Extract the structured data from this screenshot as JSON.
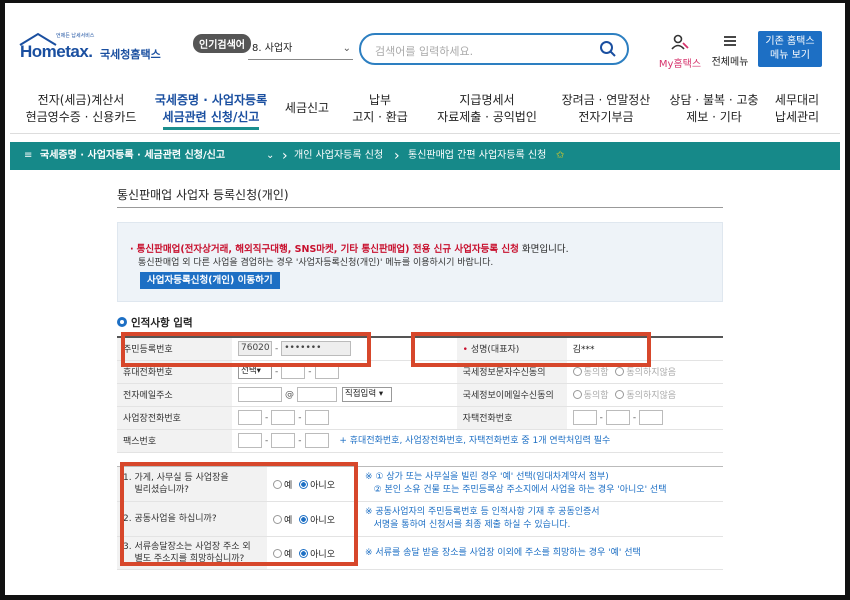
{
  "header": {
    "logo_text": "Hometax.",
    "logo_sub": "국세청홈택스",
    "logo_tiny": "언제든 납세서비스",
    "popular_badge": "인기검색어",
    "popular_item": "8.  사업자",
    "search_placeholder": "검색어를 입력하세요.",
    "my_home": "My홈택스",
    "all_menu": "전체메뉴",
    "old_button_line1": "기존 홈택스",
    "old_button_line2": "메뉴 보기"
  },
  "gnb": [
    {
      "line1": "전자(세금)계산서",
      "line2": "현금영수증 · 신용카드"
    },
    {
      "line1": "국세증명 · 사업자등록",
      "line2": "세금관련 신청/신고"
    },
    {
      "line1": "세금신고",
      "line2": ""
    },
    {
      "line1": "납부",
      "line2": "고지 · 환급"
    },
    {
      "line1": "지급명세서",
      "line2": "자료제출 · 공익법인"
    },
    {
      "line1": "장려금 · 연말정산",
      "line2": "전자기부금"
    },
    {
      "line1": "상담 · 불복 · 고충",
      "line2": "제보 · 기타"
    },
    {
      "line1": "세무대리",
      "line2": "납세관리"
    }
  ],
  "breadcrumb": {
    "menu": "국세증명 · 사업자등록 · 세금관련 신청/신고",
    "step1": "개인 사업자등록 신청",
    "step2": "통신판매업 간편 사업자등록 신청",
    "star": "✩"
  },
  "page": {
    "title": "통신판매업 사업자 등록신청(개인)",
    "notice_bullet": "·",
    "notice_red": "통신판매업(전자상거래, 해외직구대행, SNS마켓, 기타 통신판매업) 전용 신규 사업자등록 신청",
    "notice_after": " 화면입니다.",
    "notice_line2": "통신판매업 외 다른 사업을 겸업하는 경우 '사업자등록신청(개인)' 메뉴를 이용하시기 바랍니다.",
    "notice_button": "사업자등록신청(개인) 이동하기",
    "section_title": "인적사항 입력"
  },
  "form": {
    "rrn_label": "주민등록번호",
    "rrn_front": "76020",
    "rrn_back": "•••••••",
    "name_label": "성명(대표자)",
    "name_value": "김***",
    "mobile_label": "휴대전화번호",
    "mobile_select": "선택",
    "info_sms_label": "국세정보문자수신동의",
    "agree": "동의함",
    "disagree": "동의하지않음",
    "email_label": "전자메일주소",
    "email_at": "@",
    "email_select": "직접입력",
    "info_email_label": "국세정보이메일수신동의",
    "biz_phone_label": "사업장전화번호",
    "home_phone_label": "자택전화번호",
    "fax_label": "팩스번호",
    "contact_hint": "+ 휴대전화번호, 사업장전화번호, 자택전화번호 중 1개 연락처입력 필수"
  },
  "questions": [
    {
      "q_line1": "1. 가게, 사무실 등 사업장을",
      "q_line2": "빌리셨습니까?",
      "yes": "예",
      "no": "아니오",
      "note_line1": "※ ① 상가 또는 사무실을 빌린 경우 '예' 선택(임대차계약서 첨부)",
      "note_line2": "② 본인 소유 건물 또는 주민등록상 주소지에서 사업을 하는 경우 '아니오' 선택"
    },
    {
      "q_line1": "2. 공동사업을 하십니까?",
      "q_line2": "",
      "yes": "예",
      "no": "아니오",
      "note_line1": "※ 공동사업자의 주민등록번호 등 인적사항 기재 후 공동인증서",
      "note_line2": "서명을 통하여 신청서를 최종 제출 하실 수 있습니다."
    },
    {
      "q_line1": "3. 서류송달장소는 사업장 주소 외",
      "q_line2": "별도 주소지를 희망하십니까?",
      "yes": "예",
      "no": "아니오",
      "note_line1": "※ 서류를 송달 받을 장소를 사업장 이외에 주소를 희망하는 경우 '예' 선택",
      "note_line2": ""
    }
  ],
  "colors": {
    "brand_blue": "#1d6fc4",
    "breadcrumb_teal": "#168989",
    "highlight_red": "#d7472b"
  }
}
